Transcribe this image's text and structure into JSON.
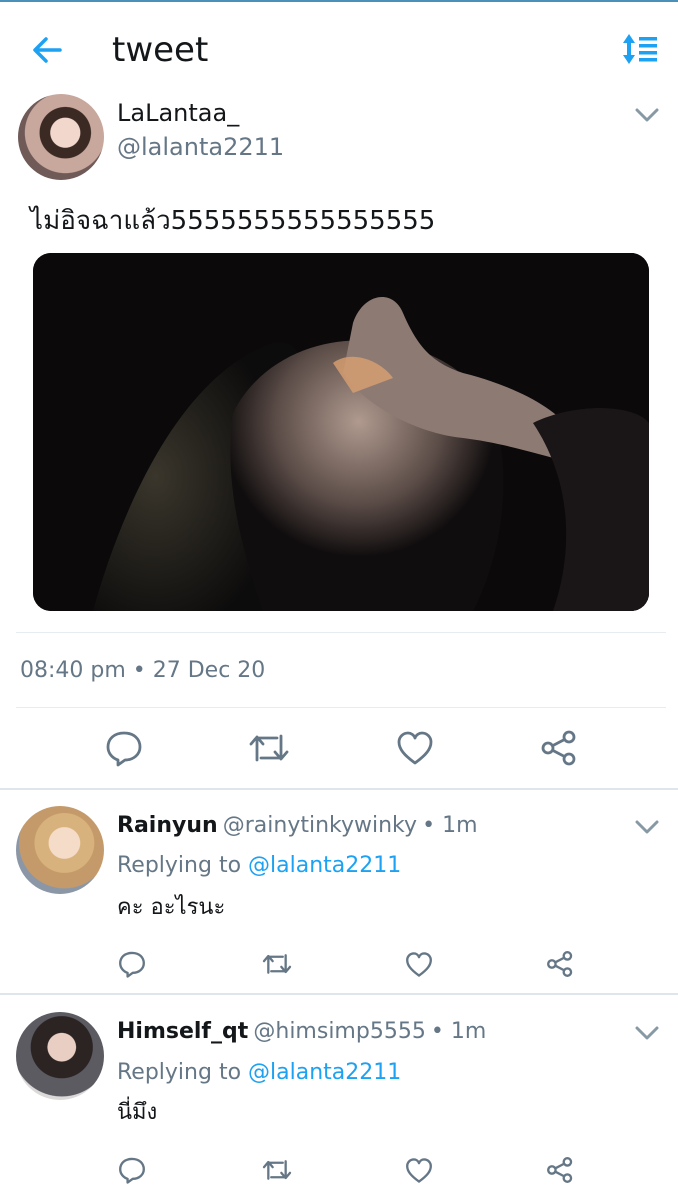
{
  "header": {
    "title": "tweet",
    "back_icon": "arrow-left-icon",
    "sort_icon": "sort-icon",
    "accent": "#1da1f2"
  },
  "tweet": {
    "name": "LaLantaa_",
    "handle": "@lalanta2211",
    "text": "ไม่อิจฉาแล้ว5555555555555555",
    "timestamp": "08:40 pm • 27 Dec 20",
    "actions": [
      "reply-icon",
      "retweet-icon",
      "like-icon",
      "share-icon"
    ]
  },
  "replies": [
    {
      "name": "Rainyun",
      "handle": "@rainytinkywinky",
      "time": "• 1m",
      "replying_prefix": "Replying to",
      "replying_to": "@lalanta2211",
      "text": "คะ อะไรนะ"
    },
    {
      "name": "Himself_qt",
      "handle": "@himsimp5555",
      "time": "• 1m",
      "replying_prefix": "Replying to",
      "replying_to": "@lalanta2211",
      "text": "นี่มึง"
    }
  ]
}
